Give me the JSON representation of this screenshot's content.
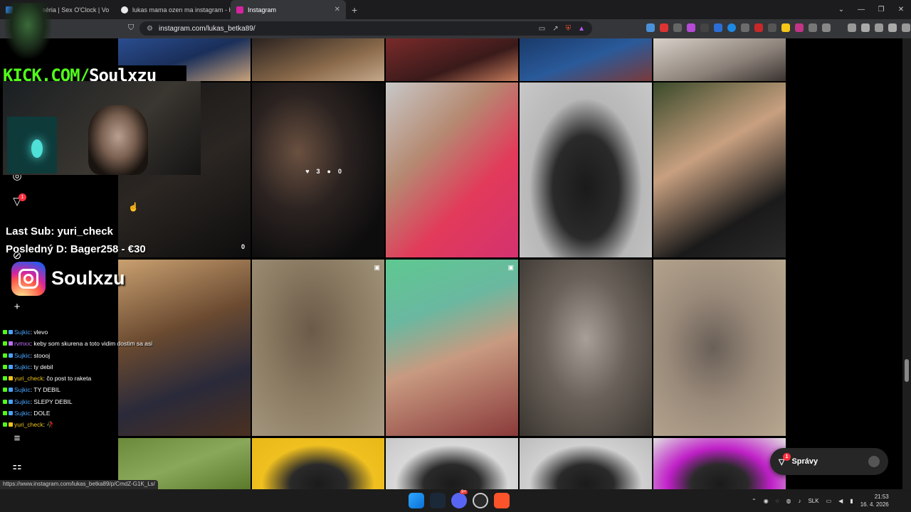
{
  "browser": {
    "tabs": [
      {
        "label": "Pr… | 2. séria | Sex O'Clock | Vo",
        "active": false,
        "favicon_color": "#2e7bd6"
      },
      {
        "label": "lukas mama ozen ma instagram - H…",
        "active": false,
        "favicon_color": "#e8e8e8"
      },
      {
        "label": "Instagram",
        "active": true,
        "favicon_color": "#d6249f"
      }
    ],
    "new_tab": "+",
    "url": "instagram.com/lukas_betka89/",
    "window_controls": [
      "⌄",
      "—",
      "❐",
      "✕"
    ]
  },
  "stream_overlay": {
    "kick_prefix": "KICK.COM/",
    "kick_channel": "Soulxzu",
    "last_sub": "Last Sub: yuri_check",
    "last_donation": "Posledný D: Bager258 - €30",
    "instagram_handle": "Soulxzu"
  },
  "posts": {
    "row1_overlay": {
      "likes_a": "0",
      "likes_b": "3",
      "comments_b": "0"
    }
  },
  "chat": [
    {
      "user": "Sujkic",
      "color": "#4aa3ff",
      "text": ": vlevo"
    },
    {
      "user": "rvmxx",
      "color": "#c06cff",
      "text": ": keby som skurena a toto vidim dostim sa asi"
    },
    {
      "user": "Sujkic",
      "color": "#4aa3ff",
      "text": ": stoooj"
    },
    {
      "user": "Sujkic",
      "color": "#4aa3ff",
      "text": ": ty debil"
    },
    {
      "user": "yuri_check",
      "color": "#f0c419",
      "text": ": čo post to raketa"
    },
    {
      "user": "Sujkic",
      "color": "#4aa3ff",
      "text": ": TY DEBIL"
    },
    {
      "user": "Sujkic",
      "color": "#4aa3ff",
      "text": ": SLEPY DEBIL"
    },
    {
      "user": "Sujkic",
      "color": "#4aa3ff",
      "text": ": DOLE"
    },
    {
      "user": "yuri_check",
      "color": "#f0c419",
      "text": ": 🥀"
    }
  ],
  "sidebar": {
    "notification_count": "1"
  },
  "messages": {
    "label": "Správy",
    "count": "1"
  },
  "status_url": "https://www.instagram.com/lukas_betka89/p/CmdZ-G1K_Ls/",
  "taskbar": {
    "language": "SLK",
    "time": "21:53",
    "date": "16. 4. 2026",
    "notification_badge": "9+"
  }
}
